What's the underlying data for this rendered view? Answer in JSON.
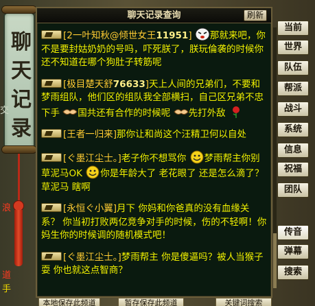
{
  "window": {
    "title": "聊天记录查询",
    "refresh_label": "刷新"
  },
  "banner": {
    "chars": [
      "聊",
      "天",
      "记",
      "录"
    ],
    "side_marks": [
      "交",
      "浪",
      "道",
      "手"
    ]
  },
  "messages": [
    {
      "sender": "[2一叶知秋@倾世女王",
      "level": "11951",
      "close": "]",
      "emoji": "face",
      "text": "那就来吧，你不是要封姑奶奶的号吗，吓死朕了，朕玩倫袭的时候你还不知道在哪个狗肚子转筋呢"
    },
    {
      "sender": "[极目楚天舒",
      "level": "76633",
      "close": "]",
      "text": "天上人间的兄弟们，不要和梦雨组队，他们区的组队我全部横扫，自己区兄弟不忠下手",
      "emoji": "handshake",
      "text2": "国共还有合作的时候呢",
      "emoji2": "handshake",
      "text3": "先打外敌",
      "emoji3": "rose"
    },
    {
      "sender": "[王者一归来]",
      "text": "那你让和尚这个汪精卫何以自处"
    },
    {
      "sender": "[ぐ墨江尘士。]",
      "text": "老子你不想骂你",
      "emoji": "smile",
      "text2": "梦雨帮主你别草泥马OK",
      "emoji2": "smile",
      "text3": "你是年龄大了 老花眼了 还是怎么滴了？草泥马 瞎啊"
    },
    {
      "sender": "[永恒ぐ小翼]",
      "text": "月下 你妈和你爸真的没有血缘关系？ 你当初打败两亿竞争对手的时候，伤的不轻啊！你妈生你的时候调的随机模式吧！"
    },
    {
      "sender": "[ぐ墨江尘士。]",
      "text": "梦雨帮主 你是傻逼吗？被人当猴子耍 你也就这点智商？"
    }
  ],
  "tabs": [
    {
      "label": "当前"
    },
    {
      "label": "世界"
    },
    {
      "label": "队伍"
    },
    {
      "label": "帮派"
    },
    {
      "label": "战斗"
    },
    {
      "label": "系统"
    },
    {
      "label": "信息"
    },
    {
      "label": "祝福"
    },
    {
      "label": "团队"
    },
    {
      "label": "传音"
    },
    {
      "label": "弹幕"
    },
    {
      "label": "搜索"
    }
  ],
  "buttons": {
    "save_page": "本地保存此频道",
    "save_channel": "暂存保存此频道",
    "keyword_search": "关键词搜索"
  },
  "colors": {
    "chat_text": "#f0f000",
    "panel_bg": "#0a1a0f",
    "accent": "#6b5e3a"
  }
}
